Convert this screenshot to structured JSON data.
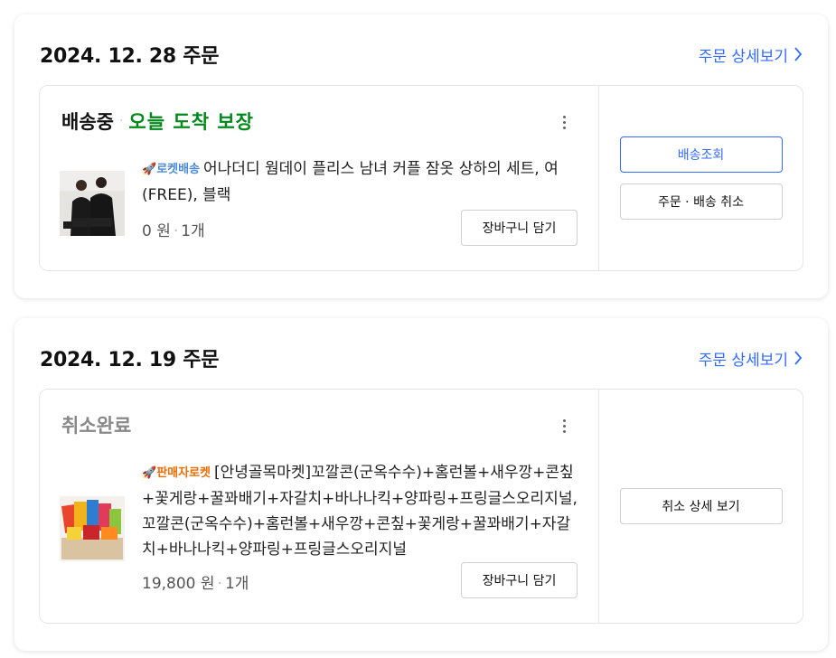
{
  "orders": [
    {
      "date": "2024. 12. 28 주문",
      "detail_label": "주문 상세보기",
      "status": "배송중",
      "status_dot": "·",
      "arrival": "오늘 도착 보장",
      "badge": "로켓배송",
      "badge_color": "#4a8ad6",
      "product": "어나더디 웜데이 플리스 남녀 커플 잠옷 상하의 세트, 여(FREE), 블랙",
      "price": "0 원",
      "quantity": "1개",
      "cart_label": "장바구니 담기",
      "actions": [
        "배송조회",
        "주문 · 배송 취소"
      ]
    },
    {
      "date": "2024. 12. 19 주문",
      "detail_label": "주문 상세보기",
      "status": "취소완료",
      "badge": "판매자로켓",
      "badge_color": "#f06b00",
      "product": "[안녕골목마켓]꼬깔콘(군옥수수)+홈런볼+새우깡+콘칲+꽃게랑+꿀꽈배기+자갈치+바나나킥+양파링+프링글스오리지널, 꼬깔콘(군옥수수)+홈런볼+새우깡+콘칲+꽃게랑+꿀꽈배기+자갈치+바나나킥+양파링+프링글스오리지널",
      "price": "19,800 원",
      "quantity": "1개",
      "cart_label": "장바구니 담기",
      "actions": [
        "취소 상세 보기"
      ]
    }
  ],
  "colors": {
    "accent": "#346aff",
    "arrival_green": "#00891a",
    "cancel_gray": "#888888"
  },
  "icons": [
    "chevron-right-icon",
    "kebab-menu-icon",
    "rocket-icon"
  ]
}
